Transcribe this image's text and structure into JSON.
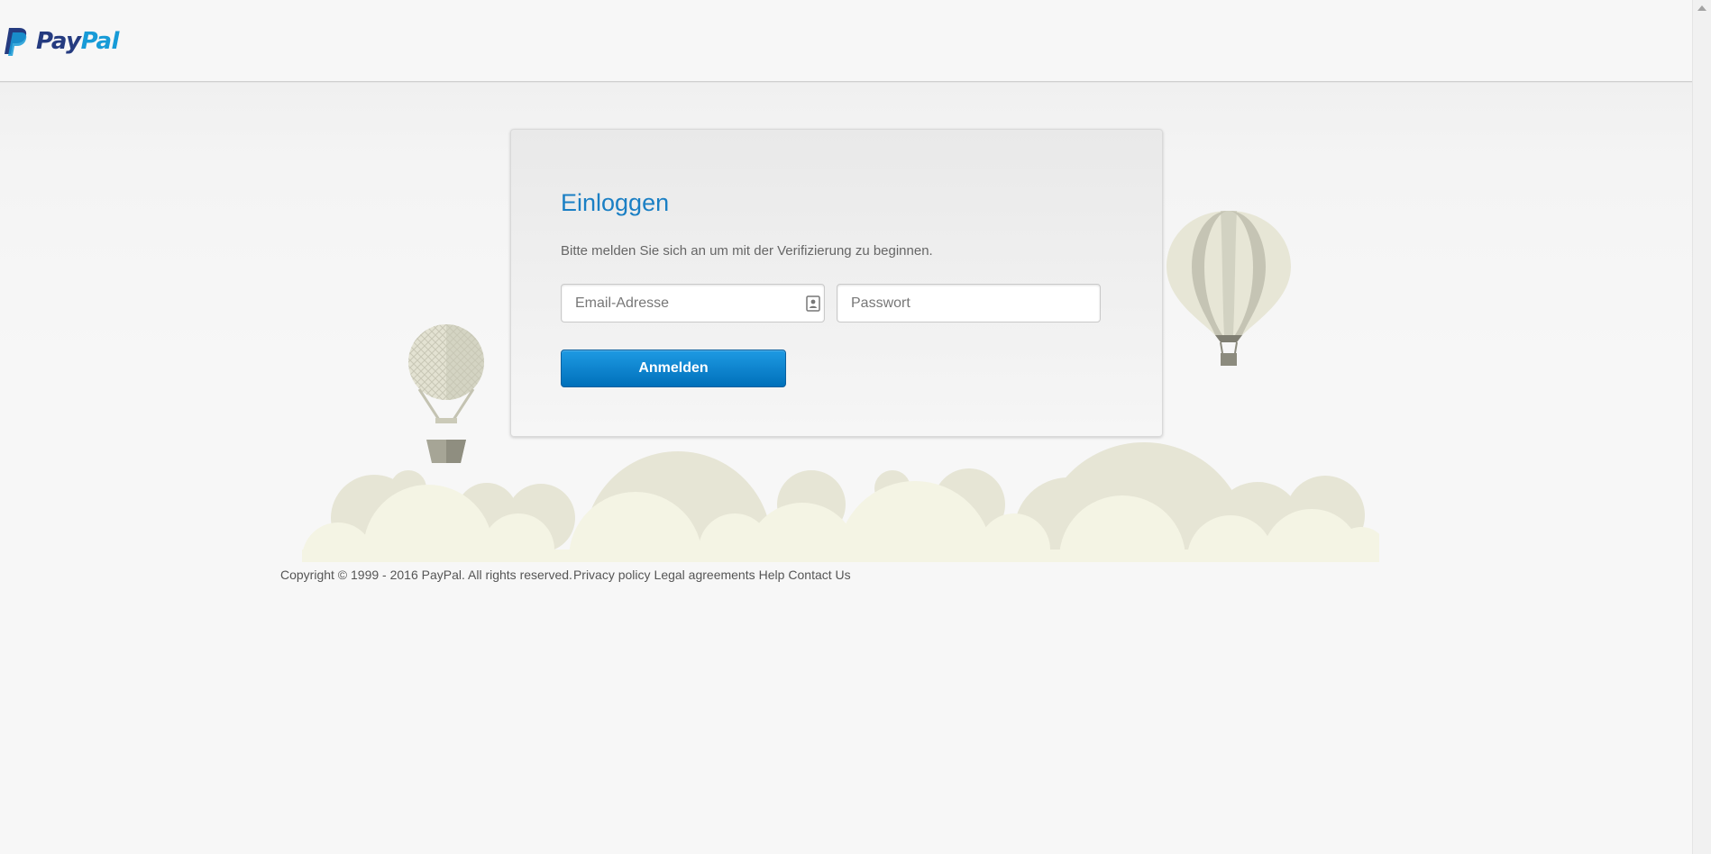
{
  "brand": {
    "name_part1": "Pay",
    "name_part2": "Pal",
    "primary_color": "#253b80",
    "secondary_color": "#179bd7"
  },
  "login": {
    "title": "Einloggen",
    "description": "Bitte melden Sie sich an um mit der Verifizierung zu beginnen.",
    "email_placeholder": "Email-Adresse",
    "email_value": "",
    "password_placeholder": "Passwort",
    "password_value": "",
    "submit_label": "Anmelden",
    "accent_color": "#1a7fc4",
    "button_color": "#0070ba"
  },
  "footer": {
    "copyright": "Copyright © 1999 - 2016 PayPal. All rights reserved.",
    "links": [
      "Privacy policy",
      "Legal agreements",
      "Help",
      "Contact Us"
    ]
  },
  "icons": {
    "email_field_icon": "contact-card-icon",
    "logo_icon": "paypal-p-icon"
  }
}
